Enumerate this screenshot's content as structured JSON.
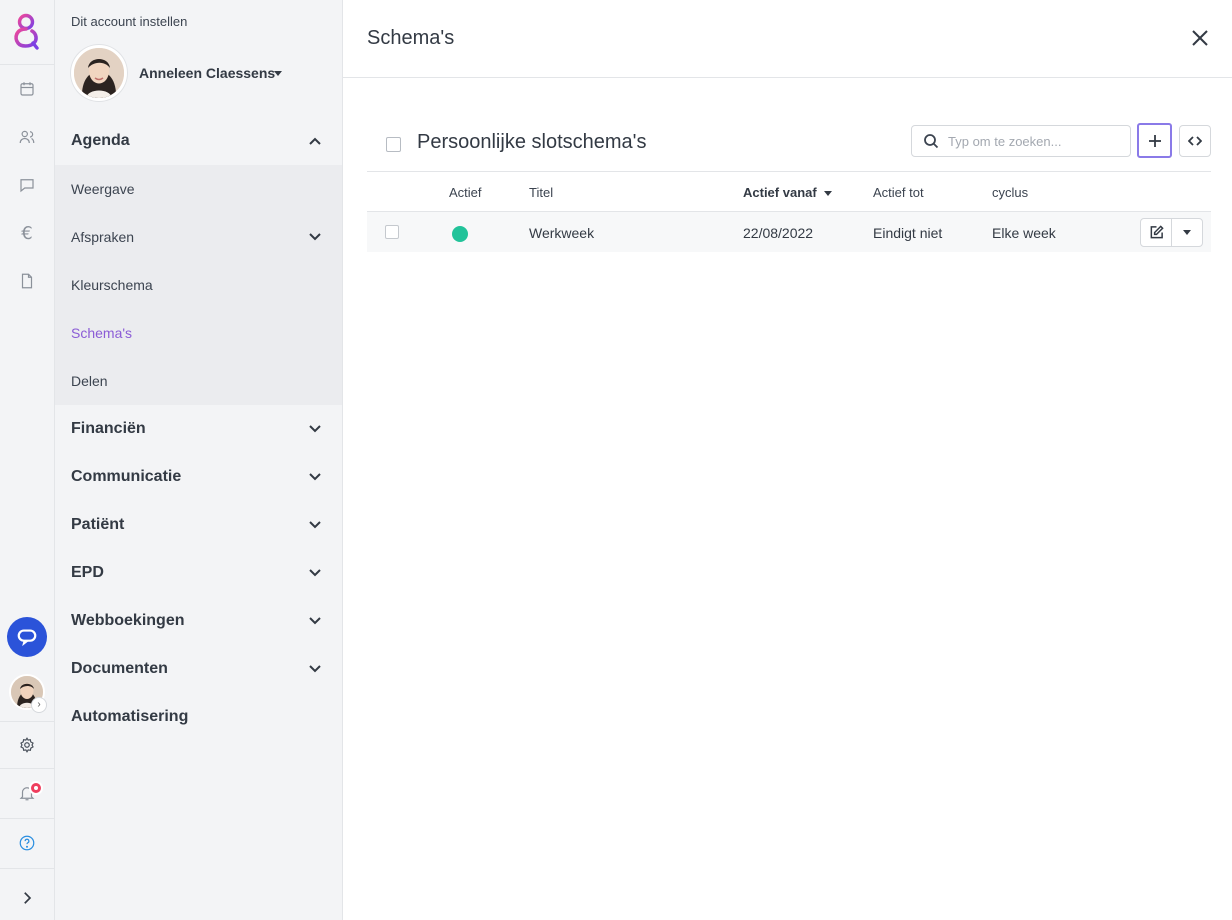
{
  "sidebar": {
    "account_label": "Dit account instellen",
    "user_name": "Anneleen Claessens",
    "sections": [
      {
        "label": "Agenda",
        "expanded": true
      },
      {
        "label": "Financiën",
        "expanded": false
      },
      {
        "label": "Communicatie",
        "expanded": false
      },
      {
        "label": "Patiënt",
        "expanded": false
      },
      {
        "label": "EPD",
        "expanded": false
      },
      {
        "label": "Webboekingen",
        "expanded": false
      },
      {
        "label": "Documenten",
        "expanded": false
      },
      {
        "label": "Automatisering",
        "expanded": false
      }
    ],
    "agenda_items": [
      {
        "label": "Weergave"
      },
      {
        "label": "Afspraken"
      },
      {
        "label": "Kleurschema"
      },
      {
        "label": "Schema's",
        "active": true
      },
      {
        "label": "Delen"
      }
    ]
  },
  "rail": {
    "icons": [
      "calendar-icon",
      "users-icon",
      "chat-icon",
      "euro-icon",
      "document-icon",
      "support-chat-icon",
      "settings-icon",
      "bell-icon",
      "help-icon",
      "expand-icon"
    ],
    "euro_glyph": "€"
  },
  "main": {
    "title": "Schema's",
    "section_title": "Persoonlijke slotschema's",
    "search_placeholder": "Typ om te zoeken...",
    "columns": {
      "actief": "Actief",
      "titel": "Titel",
      "actief_vanaf": "Actief vanaf",
      "actief_tot": "Actief tot",
      "cyclus": "cyclus"
    },
    "sorted_column": "Actief vanaf",
    "rows": [
      {
        "active": true,
        "titel": "Werkweek",
        "actief_vanaf": "22/08/2022",
        "actief_tot": "Eindigt niet",
        "cyclus": "Elke week"
      }
    ]
  },
  "colors": {
    "accent": "#8b5cd6",
    "status_active": "#22c39a",
    "chat_button": "#2b53d9",
    "notification": "#ef3e5e"
  }
}
